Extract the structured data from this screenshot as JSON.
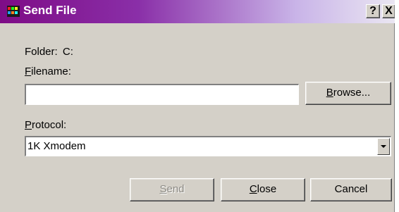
{
  "window": {
    "title": "Send File",
    "help_label": "?",
    "close_label": "X"
  },
  "folder": {
    "label": "Folder:",
    "value": "C:"
  },
  "filename": {
    "label_prefix": "",
    "label_accel": "F",
    "label_rest": "ilename:",
    "value": ""
  },
  "browse_button": {
    "accel": "B",
    "rest": "rowse..."
  },
  "protocol": {
    "label_accel": "P",
    "label_rest": "rotocol:",
    "selected": "1K Xmodem"
  },
  "buttons": {
    "send": {
      "accel": "S",
      "rest": "end",
      "enabled": false
    },
    "close": {
      "accel": "C",
      "rest": "lose"
    },
    "cancel": {
      "label": "Cancel"
    }
  },
  "colors": {
    "titlebar_start": "#7e0c86",
    "titlebar_end": "#eae6f2",
    "face": "#d4d0c8"
  }
}
